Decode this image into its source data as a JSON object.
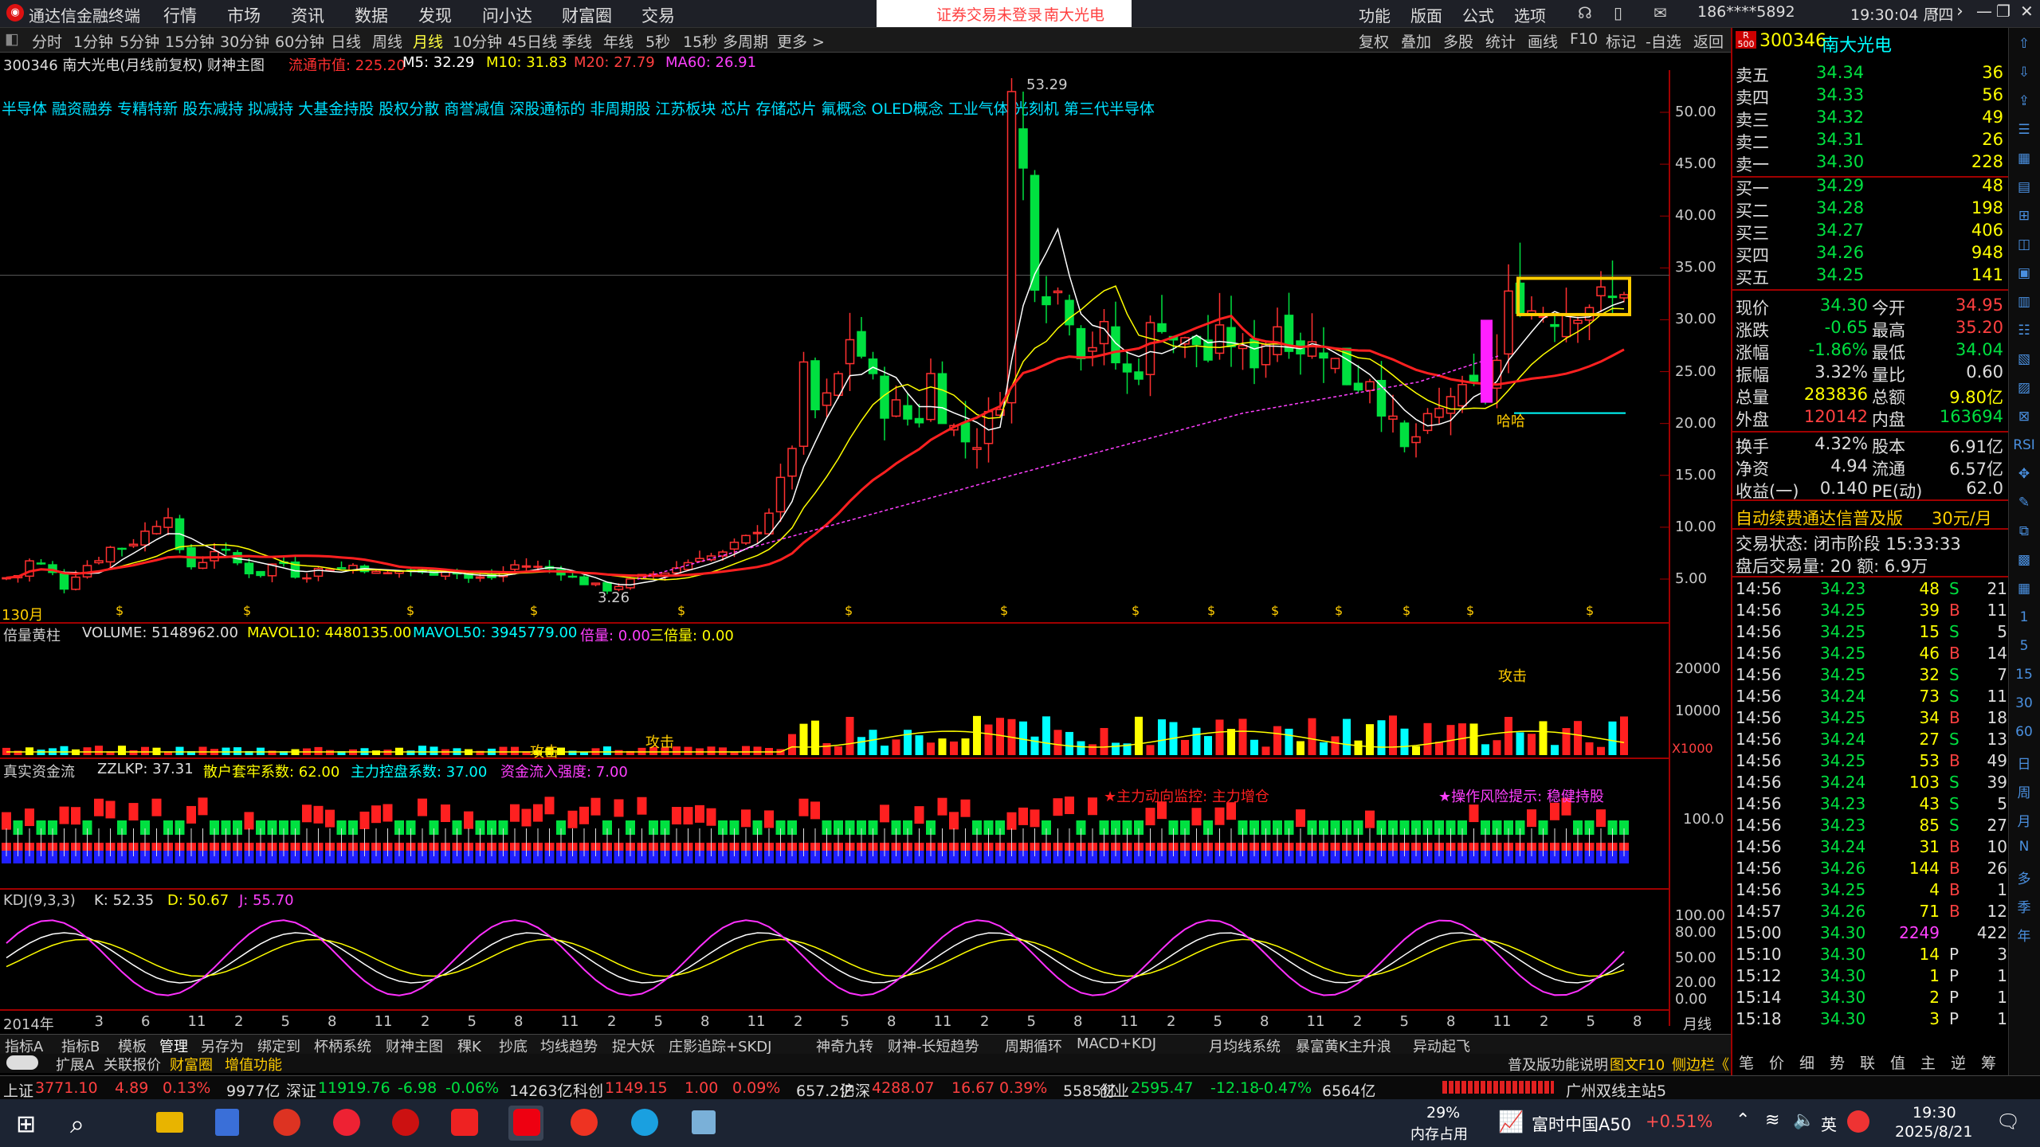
{
  "app": {
    "title": "通达信金融终端",
    "menus": [
      "行情",
      "市场",
      "资讯",
      "数据",
      "发现",
      "问小达",
      "财富圈",
      "交易"
    ],
    "notice": [
      "证券交易未登录",
      "南大光电"
    ],
    "right_menus": [
      "功能",
      "版面",
      "公式",
      "选项"
    ],
    "account": "186****5892",
    "clock": "19:30:04 周四"
  },
  "periods": [
    "分时",
    "1分钟",
    "5分钟",
    "15分钟",
    "30分钟",
    "60分钟",
    "日线",
    "周线",
    "月线",
    "10分钟",
    "45日线",
    "季线",
    "年线",
    "5秒",
    "15秒",
    "多周期",
    "更多 >"
  ],
  "right_tools": [
    "复权",
    "叠加",
    "多股",
    "统计",
    "画线",
    "F10",
    "标记",
    "-自选",
    "返回"
  ],
  "header": {
    "code": "300346 南大光电(月线前复权)",
    "indicator": "财神主图",
    "float_cap": "流通市值: 225.20",
    "m5": "M5: 32.29",
    "m10": "M10: 31.83",
    "m20": "M20: 27.79",
    "ma60": "MA60: 26.91"
  },
  "concepts": "半导体 融资融券 专精特新 股东减持 拟减持 大基金持股 股权分散 商誉减值 深股通标的 非周期股 江苏板块 芯片 存储芯片 氟概念 OLED概念 工业气体 光刻机 第三代半导体",
  "annotations": {
    "high": "53.29",
    "low": "3.26",
    "period_tag": "130月",
    "attack1": "攻击",
    "attack2": "攻击",
    "attack3": "攻击",
    "haha": "哈哈",
    "monitor": "★主力动向监控: 主力增仓",
    "risk": "★操作风险提示: 稳健持股"
  },
  "volume_header": {
    "name": "倍量黄柱",
    "volume": "VOLUME: 5148962.00",
    "mavol10": "MAVOL10: 4480135.00",
    "mavol50": "MAVOL50: 3945779.00",
    "double": "倍量: 0.00",
    "triple": "三倍量: 0.00",
    "unit": "X1000"
  },
  "fund_header": {
    "name": "真实资金流",
    "zzlkp": "ZZLKP: 37.31",
    "retail": "散户套牢系数: 62.00",
    "main": "主力控盘系数: 37.00",
    "inflow": "资金流入强度: 7.00"
  },
  "kdj_header": {
    "name": "KDJ(9,3,3)",
    "k": "K: 52.35",
    "d": "D: 50.67",
    "j": "J: 55.70"
  },
  "price_axis": [
    "50.00",
    "45.00",
    "40.00",
    "35.00",
    "30.00",
    "25.00",
    "20.00",
    "15.00",
    "10.00",
    "5.00"
  ],
  "vol_axis": [
    "20000",
    "10000"
  ],
  "fund_axis": [
    "100.0"
  ],
  "kdj_axis": [
    "100.00",
    "80.00",
    "50.00",
    "20.00",
    "0.00"
  ],
  "date_axis": [
    "2014年",
    "3",
    "6",
    "11",
    "2",
    "5",
    "8",
    "11",
    "2",
    "5",
    "8",
    "11",
    "2",
    "5",
    "8",
    "11",
    "2",
    "5",
    "8",
    "11",
    "2",
    "5",
    "8",
    "11",
    "2",
    "5",
    "8",
    "11",
    "2",
    "5",
    "8",
    "11",
    "2",
    "5",
    "8"
  ],
  "date_axis_tail": "月线",
  "chart_data": {
    "type": "candlestick",
    "x_label": "月线 2014年起",
    "ylim": [
      0,
      55
    ],
    "high": 53.29,
    "low": 3.26,
    "ma_legend": [
      "M5",
      "M10",
      "M20",
      "MA60"
    ],
    "last": {
      "m5": 32.29,
      "m10": 31.83,
      "m20": 27.79,
      "ma60": 26.91,
      "volume": 5148962,
      "k": 52.35,
      "d": 50.67,
      "j": 55.7
    }
  },
  "quote": {
    "code": "300346",
    "name": "南大光电",
    "asks": [
      [
        "卖五",
        "34.34",
        "36"
      ],
      [
        "卖四",
        "34.33",
        "56"
      ],
      [
        "卖三",
        "34.32",
        "49"
      ],
      [
        "卖二",
        "34.31",
        "26"
      ],
      [
        "卖一",
        "34.30",
        "228"
      ]
    ],
    "bids": [
      [
        "买一",
        "34.29",
        "48"
      ],
      [
        "买二",
        "34.28",
        "198"
      ],
      [
        "买三",
        "34.27",
        "406"
      ],
      [
        "买四",
        "34.26",
        "948"
      ],
      [
        "买五",
        "34.25",
        "141"
      ]
    ],
    "stats": [
      [
        "现价",
        "34.30",
        "今开",
        "34.95"
      ],
      [
        "涨跌",
        "-0.65",
        "最高",
        "35.20"
      ],
      [
        "涨幅",
        "-1.86%",
        "最低",
        "34.04"
      ],
      [
        "振幅",
        "3.32%",
        "量比",
        "0.60"
      ],
      [
        "总量",
        "283836",
        "总额",
        "9.80亿"
      ],
      [
        "外盘",
        "120142",
        "内盘",
        "163694"
      ],
      [
        "换手",
        "4.32%",
        "股本",
        "6.91亿"
      ],
      [
        "净资",
        "4.94",
        "流通",
        "6.57亿"
      ],
      [
        "收益(一)",
        "0.140",
        "PE(动)",
        "62.0"
      ]
    ],
    "promo": "自动续费通达信普及版",
    "promo_price": "30元/月",
    "trade_state": "交易状态: 闭市阶段 15:33:33",
    "after_hours": "盘后交易量: 20 额: 6.9万",
    "ticks": [
      [
        "14:56",
        "34.23",
        "48",
        "S",
        "21"
      ],
      [
        "14:56",
        "34.25",
        "39",
        "B",
        "11"
      ],
      [
        "14:56",
        "34.25",
        "15",
        "S",
        "5"
      ],
      [
        "14:56",
        "34.25",
        "46",
        "B",
        "14"
      ],
      [
        "14:56",
        "34.25",
        "32",
        "S",
        "7"
      ],
      [
        "14:56",
        "34.24",
        "73",
        "S",
        "11"
      ],
      [
        "14:56",
        "34.25",
        "34",
        "B",
        "18"
      ],
      [
        "14:56",
        "34.24",
        "27",
        "S",
        "13"
      ],
      [
        "14:56",
        "34.25",
        "53",
        "B",
        "49"
      ],
      [
        "14:56",
        "34.24",
        "103",
        "S",
        "39"
      ],
      [
        "14:56",
        "34.23",
        "43",
        "S",
        "5"
      ],
      [
        "14:56",
        "34.23",
        "85",
        "S",
        "27"
      ],
      [
        "14:56",
        "34.24",
        "31",
        "B",
        "10"
      ],
      [
        "14:56",
        "34.26",
        "144",
        "B",
        "26"
      ],
      [
        "14:56",
        "34.25",
        "4",
        "B",
        "1"
      ],
      [
        "14:57",
        "34.26",
        "71",
        "B",
        "12"
      ],
      [
        "15:00",
        "34.30",
        "2249",
        "",
        "422"
      ],
      [
        "15:10",
        "34.30",
        "14",
        "P",
        "3"
      ],
      [
        "15:12",
        "34.30",
        "1",
        "P",
        "1"
      ],
      [
        "15:14",
        "34.30",
        "2",
        "P",
        "1"
      ],
      [
        "15:18",
        "34.30",
        "3",
        "P",
        "1"
      ]
    ],
    "bottom_tabs": [
      "笔",
      "价",
      "细",
      "势",
      "联",
      "值",
      "主",
      "逆",
      "筹"
    ]
  },
  "tabs1": [
    "指标A",
    "指标B",
    "模板",
    "管理",
    "另存为",
    "绑定到",
    "杯柄系统",
    "财神主图",
    "稞K",
    "抄底",
    "均线趋势",
    "捉大妖",
    "庄影追踪+SKDJ",
    "神奇九转",
    "财神-长短趋势",
    "周期循环",
    "MACD+KDJ",
    "月均线系统",
    "暴富黄K主升浪",
    "异动起飞"
  ],
  "tabs2": [
    "扩展A",
    "关联报价",
    "财富圈",
    "增值功能"
  ],
  "tabs2_right": [
    "普及版功能说明",
    "图文F10",
    "侧边栏《"
  ],
  "indices": [
    {
      "name": "上证",
      "value": "3771.10",
      "chg": "4.89",
      "pct": "0.13%",
      "amt": "9977亿"
    },
    {
      "name": "深证",
      "value": "11919.76",
      "chg": "-6.98",
      "pct": "-0.06%",
      "amt": "14263亿"
    },
    {
      "name": "科创",
      "value": "1149.15",
      "chg": "1.00",
      "pct": "0.09%",
      "amt": "657.2亿"
    },
    {
      "name": "沪深",
      "value": "4288.07",
      "chg": "16.67",
      "pct": "0.39%",
      "amt": "5585亿"
    },
    {
      "name": "创业",
      "value": "2595.47",
      "chg": "-12.18",
      "pct": "-0.47%",
      "amt": "6564亿"
    }
  ],
  "server": "广州双线主站5",
  "taskbar": {
    "mem": "29%",
    "mem_label": "内存占用",
    "ticker": "富时中国A50",
    "ticker_pct": "+0.51%",
    "ime": "英",
    "time": "19:30",
    "date": "2025/8/21"
  },
  "icons": [
    "windows-icon",
    "search-icon",
    "folder-icon",
    "calculator-icon",
    "tdx-icon",
    "browser-icon",
    "app-icon",
    "wps-icon",
    "stock-icon",
    "netease-icon",
    "edge-icon",
    "notepad-icon"
  ]
}
